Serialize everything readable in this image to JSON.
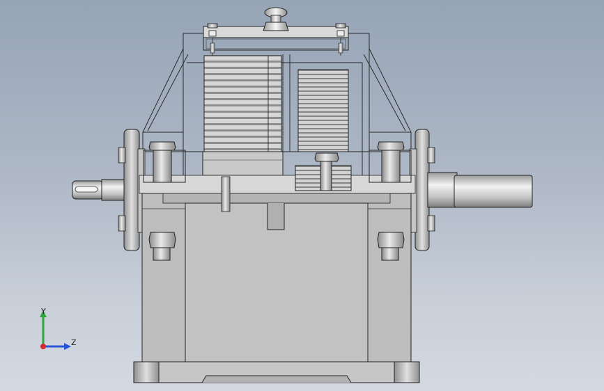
{
  "view": {
    "background_top": "#96a4b6",
    "background_bottom": "#d4d9e1",
    "part_fill": "#bcbcbc",
    "part_shade": "#9a9a9a",
    "edge_color": "#222222"
  },
  "triad": {
    "y_label": "Y",
    "z_label": "Z",
    "y_color": "#2fa53a",
    "z_color": "#2b55d6",
    "x_color": "#d42a2a"
  }
}
